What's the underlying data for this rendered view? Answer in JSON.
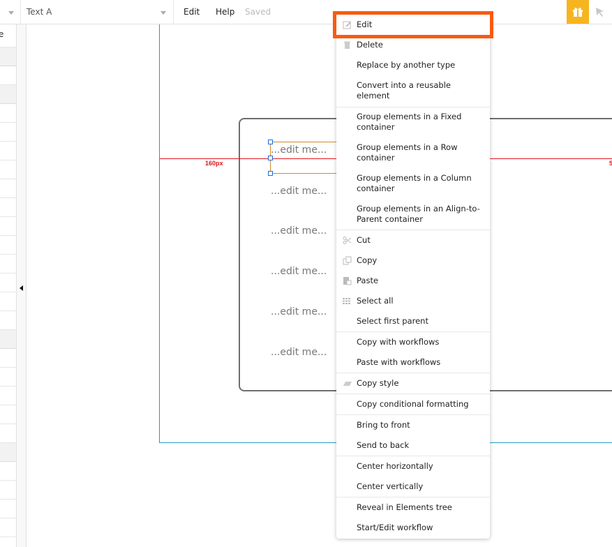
{
  "topbar": {
    "element_select": "Text A",
    "menu": {
      "edit": "Edit",
      "help": "Help"
    },
    "status": "Saved",
    "icons": {
      "gift": "gift-icon",
      "pointer": "cursor-arrow-icon"
    },
    "colors": {
      "gift_bg": "#f6b51e"
    }
  },
  "left_panel": {
    "partial_text": "e"
  },
  "canvas": {
    "texts": [
      "...edit me...",
      "...edit me...",
      "...edit me...",
      "...edit me...",
      "...edit me...",
      "...edit me..."
    ],
    "guide_left_label": "160px",
    "guide_right_label": "5",
    "colors": {
      "canvas_border": "#1e9dbd",
      "guide": "#e0141e",
      "selection": "#d18a2a",
      "handle": "#1a6be0"
    }
  },
  "context_menu": {
    "highlight_color": "#fa5a0f",
    "items": [
      {
        "label": "Edit",
        "icon": "pencil-icon"
      },
      {
        "label": "Delete",
        "icon": "trash-icon"
      },
      {
        "label": "Replace by another type",
        "icon": ""
      },
      {
        "label": "Convert into a reusable element",
        "icon": ""
      },
      {
        "label": "Group elements in a Fixed container",
        "icon": ""
      },
      {
        "label": "Group elements in a Row container",
        "icon": ""
      },
      {
        "label": "Group elements in a Column container",
        "icon": ""
      },
      {
        "label": "Group elements in an Align-to-Parent container",
        "icon": ""
      },
      {
        "label": "Cut",
        "icon": "scissors-icon"
      },
      {
        "label": "Copy",
        "icon": "copy-icon"
      },
      {
        "label": "Paste",
        "icon": "paste-icon"
      },
      {
        "label": "Select all",
        "icon": "grid-icon"
      },
      {
        "label": "Select first parent",
        "icon": ""
      },
      {
        "label": "Copy with workflows",
        "icon": ""
      },
      {
        "label": "Paste with workflows",
        "icon": ""
      },
      {
        "label": "Copy style",
        "icon": "eraser-icon"
      },
      {
        "label": "Copy conditional formatting",
        "icon": ""
      },
      {
        "label": "Bring to front",
        "icon": ""
      },
      {
        "label": "Send to back",
        "icon": ""
      },
      {
        "label": "Center horizontally",
        "icon": ""
      },
      {
        "label": "Center vertically",
        "icon": ""
      },
      {
        "label": "Reveal in Elements tree",
        "icon": ""
      },
      {
        "label": "Start/Edit workflow",
        "icon": ""
      }
    ]
  }
}
